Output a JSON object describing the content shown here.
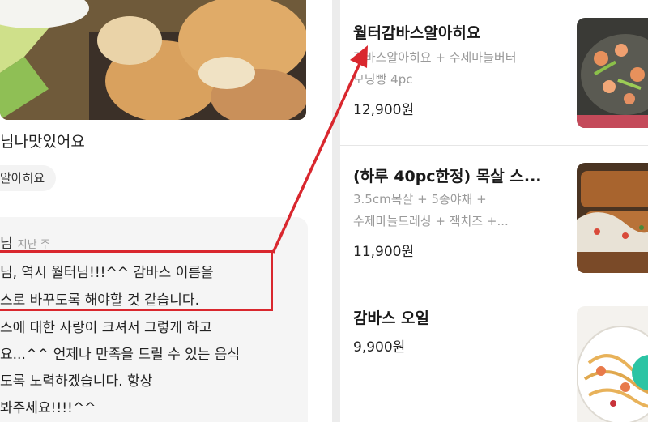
{
  "review": {
    "text": "님나맛있어요",
    "ordered_item": "알아히요"
  },
  "reply": {
    "author": "님",
    "time": "지난 주",
    "lines": [
      "님, 역시 월터님!!!^^ 감바스 이름을",
      "스로 바꾸도록 해야할 것 같습니다.",
      "스에 대한 사랑이 크셔서 그렇게 하고",
      "요...^^ 언제나 만족을 드릴 수 있는 음식",
      "도록 노력하겠습니다. 항상",
      "봐주세요!!!!^^"
    ],
    "highlight_tail": "월터"
  },
  "menu": {
    "items": [
      {
        "name": "월터감바스알아히요",
        "desc": [
          "감바스알아히요 + 수제마늘버터",
          "모닝빵 4pc"
        ],
        "price": "12,900원"
      },
      {
        "name": "(하루 40pc한정) 목살 스...",
        "desc": [
          "3.5cm목살 + 5종야채 +",
          "수제마늘드레싱 + 잭치즈 +..."
        ],
        "price": "11,900원"
      },
      {
        "name": "감바스 오일",
        "desc": [],
        "price": "9,900원"
      }
    ]
  },
  "colors": {
    "highlight": "#d9272e",
    "accent": "#2bc4a4"
  }
}
